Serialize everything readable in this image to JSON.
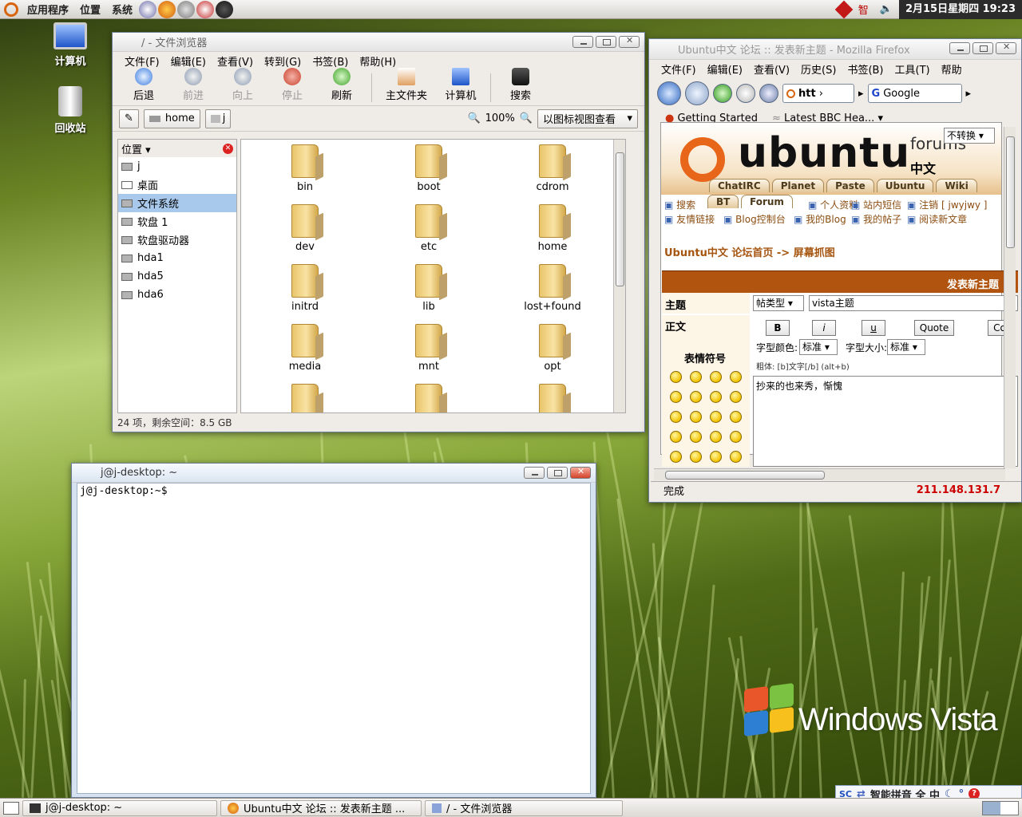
{
  "top_panel": {
    "menus": [
      "应用程序",
      "位置",
      "系统"
    ],
    "clock": "2月15日星期四 19:23",
    "tray_text": "智"
  },
  "desktop": {
    "icons": [
      {
        "label": "计算机"
      },
      {
        "label": "回收站"
      }
    ],
    "brand": "Windows Vista"
  },
  "nautilus": {
    "title": "/ - 文件浏览器",
    "menus": [
      "文件(F)",
      "编辑(E)",
      "查看(V)",
      "转到(G)",
      "书签(B)",
      "帮助(H)"
    ],
    "toolbar": {
      "back": "后退",
      "forward": "前进",
      "up": "向上",
      "stop": "停止",
      "reload": "刷新",
      "home": "主文件夹",
      "computer": "计算机",
      "search": "搜索"
    },
    "location": {
      "crumb_home": "home",
      "crumb_j": "j",
      "zoom": "100%",
      "view_mode": "以图标视图查看"
    },
    "sidebar": {
      "title": "位置",
      "items": [
        "j",
        "桌面",
        "文件系统",
        "软盘 1",
        "软盘驱动器",
        "hda1",
        "hda5",
        "hda6"
      ]
    },
    "folders": [
      "bin",
      "boot",
      "cdrom",
      "dev",
      "etc",
      "home",
      "initrd",
      "lib",
      "lost+found",
      "media",
      "mnt",
      "opt"
    ],
    "status": "24 项，剩余空间：8.5 GB"
  },
  "terminal": {
    "title": "j@j-desktop: ~",
    "prompt": "j@j-desktop:~$"
  },
  "firefox": {
    "title": "Ubuntu中文 论坛 :: 发表新主题 - Mozilla Firefox",
    "menus": [
      "文件(F)",
      "编辑(E)",
      "查看(V)",
      "历史(S)",
      "书签(B)",
      "工具(T)",
      "帮助"
    ],
    "url": "htt",
    "search_engine": "Google",
    "bookmarks": [
      "Getting Started",
      "Latest BBC Hea..."
    ],
    "banner": {
      "brand": "ubuntu",
      "forums": "forums",
      "cn": "中文",
      "convert": "不转换"
    },
    "tabs": [
      "ChatIRC",
      "Planet",
      "Paste",
      "Ubuntu",
      "Wiki"
    ],
    "subtabs": [
      "BT",
      "Forum"
    ],
    "links_row1": [
      "搜索",
      "个人资料",
      "站内短信",
      "注销 [ jwyjwy ]"
    ],
    "links_row2": [
      "友情链接",
      "Blog控制台",
      "我的Blog",
      "我的帖子",
      "阅读新文章"
    ],
    "breadcrumb": "Ubuntu中文 论坛首页 -> 屏幕抓图",
    "post_header": "发表新主题",
    "subject_label": "主题",
    "post_type": "帖类型",
    "subject_value": "vista主题",
    "body_label": "正文",
    "format_buttons": [
      "B",
      "i",
      "u",
      "Quote",
      "Co"
    ],
    "font_color_label": "字型颜色:",
    "font_color_value": "标准",
    "font_size_label": "字型大小:",
    "font_size_value": "标准",
    "hint": "粗体: [b]文字[/b]  (alt+b)",
    "smilies_label": "表情符号",
    "body_text": "抄来的也来秀，惭愧",
    "status": "完成",
    "ip": "211.148.131.7"
  },
  "taskbar": {
    "tasks": [
      "j@j-desktop: ~",
      "Ubuntu中文 论坛 :: 发表新主题 ...",
      "/ - 文件浏览器"
    ]
  },
  "ime": {
    "label": "智能拼音 全 中"
  }
}
